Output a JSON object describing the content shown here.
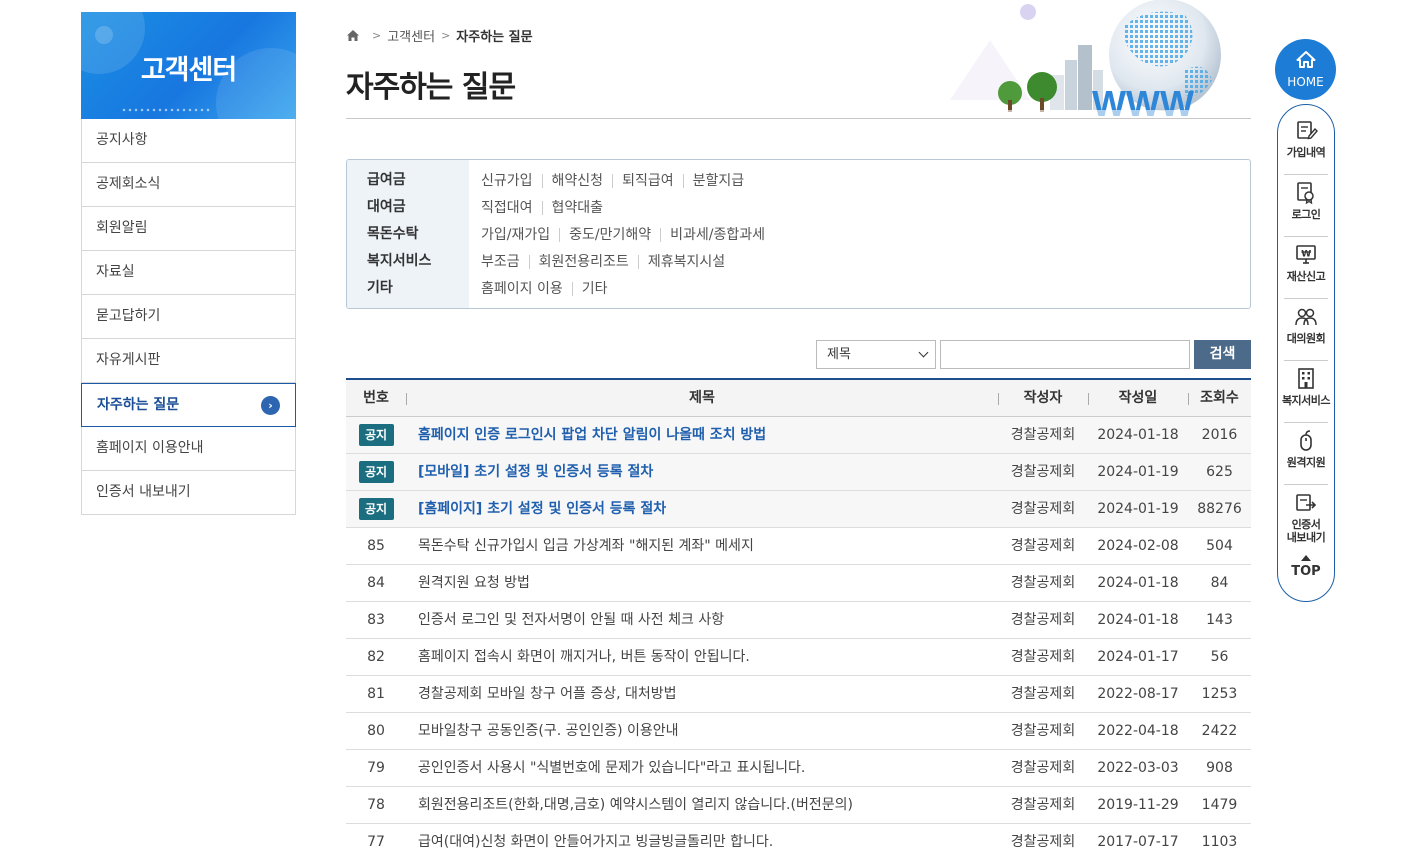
{
  "sidebar": {
    "title": "고객센터",
    "items": [
      {
        "label": "공지사항"
      },
      {
        "label": "공제회소식"
      },
      {
        "label": "회원알림"
      },
      {
        "label": "자료실"
      },
      {
        "label": "묻고답하기"
      },
      {
        "label": "자유게시판"
      },
      {
        "label": "자주하는 질문",
        "active": true
      },
      {
        "label": "홈페이지 이용안내"
      },
      {
        "label": "인증서 내보내기"
      }
    ]
  },
  "breadcrumb": {
    "home_icon": "home-icon",
    "level1": "고객센터",
    "current": "자주하는 질문"
  },
  "page_title": "자주하는 질문",
  "banner": {
    "text": "WWW"
  },
  "categories": [
    {
      "name": "급여금",
      "links": [
        "신규가입",
        "해약신청",
        "퇴직급여",
        "분할지급"
      ]
    },
    {
      "name": "대여금",
      "links": [
        "직접대여",
        "협약대출"
      ]
    },
    {
      "name": "목돈수탁",
      "links": [
        "가입/재가입",
        "중도/만기해약",
        "비과세/종합과세"
      ]
    },
    {
      "name": "복지서비스",
      "links": [
        "부조금",
        "회원전용리조트",
        "제휴복지시설"
      ]
    },
    {
      "name": "기타",
      "links": [
        "홈페이지 이용",
        "기타"
      ]
    }
  ],
  "search": {
    "select_value": "제목",
    "input_value": "",
    "button_label": "검색"
  },
  "table": {
    "headers": {
      "no": "번호",
      "title": "제목",
      "writer": "작성자",
      "date": "작성일",
      "views": "조회수"
    },
    "notice_label": "공지",
    "rows": [
      {
        "no": "공지",
        "notice": true,
        "title": "홈페이지 인증 로그인시 팝업 차단 알림이 나올때 조치 방법",
        "writer": "경찰공제회",
        "date": "2024-01-18",
        "views": "2016"
      },
      {
        "no": "공지",
        "notice": true,
        "title": "[모바일] 초기 설정 및 인증서 등록 절차",
        "writer": "경찰공제회",
        "date": "2024-01-19",
        "views": "625"
      },
      {
        "no": "공지",
        "notice": true,
        "title": "[홈페이지] 초기 설정 및 인증서 등록 절차",
        "writer": "경찰공제회",
        "date": "2024-01-19",
        "views": "88276"
      },
      {
        "no": "85",
        "notice": false,
        "title": "목돈수탁 신규가입시 입금 가상계좌 \"해지된 계좌\" 메세지",
        "writer": "경찰공제회",
        "date": "2024-02-08",
        "views": "504"
      },
      {
        "no": "84",
        "notice": false,
        "title": "원격지원 요청 방법",
        "writer": "경찰공제회",
        "date": "2024-01-18",
        "views": "84"
      },
      {
        "no": "83",
        "notice": false,
        "title": "인증서 로그인 및 전자서명이 안될 때 사전 체크 사항",
        "writer": "경찰공제회",
        "date": "2024-01-18",
        "views": "143"
      },
      {
        "no": "82",
        "notice": false,
        "title": "홈페이지 접속시 화면이 깨지거나, 버튼 동작이 안됩니다.",
        "writer": "경찰공제회",
        "date": "2024-01-17",
        "views": "56"
      },
      {
        "no": "81",
        "notice": false,
        "title": "경찰공제회 모바일 창구 어플 증상, 대처방법",
        "writer": "경찰공제회",
        "date": "2022-08-17",
        "views": "1253"
      },
      {
        "no": "80",
        "notice": false,
        "title": "모바일창구 공동인증(구. 공인인증) 이용안내",
        "writer": "경찰공제회",
        "date": "2022-04-18",
        "views": "2422"
      },
      {
        "no": "79",
        "notice": false,
        "title": "공인인증서 사용시 \"식별번호에 문제가 있습니다\"라고 표시됩니다.",
        "writer": "경찰공제회",
        "date": "2022-03-03",
        "views": "908"
      },
      {
        "no": "78",
        "notice": false,
        "title": "회원전용리조트(한화,대명,금호) 예약시스템이 열리지 않습니다.(버전문의)",
        "writer": "경찰공제회",
        "date": "2019-11-29",
        "views": "1479"
      },
      {
        "no": "77",
        "notice": false,
        "title": "급여(대여)신청 화면이 안들어가지고 빙글빙글돌리만 합니다.",
        "writer": "경찰공제회",
        "date": "2017-07-17",
        "views": "1103"
      }
    ]
  },
  "quick_menu": {
    "home_label": "HOME",
    "items": [
      {
        "label": "가입내역",
        "icon": "document-edit-icon"
      },
      {
        "label": "로그인",
        "icon": "certificate-icon"
      },
      {
        "label": "재산신고",
        "icon": "won-monitor-icon"
      },
      {
        "label": "대의원회",
        "icon": "people-icon"
      },
      {
        "label": "복지서비스",
        "icon": "building-icon"
      },
      {
        "label": "원격지원",
        "icon": "mouse-icon"
      },
      {
        "label": "인증서\n내보내기",
        "icon": "export-icon"
      }
    ],
    "top_label": "TOP"
  }
}
